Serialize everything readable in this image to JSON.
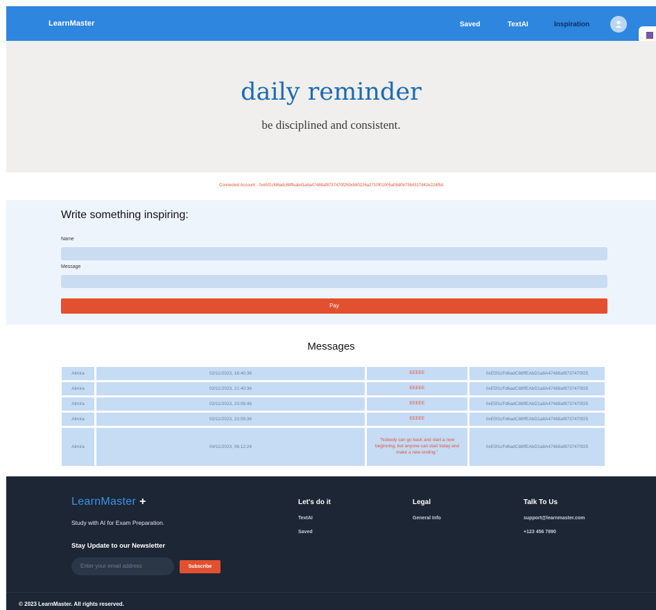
{
  "header": {
    "brand": "LearnMaster",
    "nav": {
      "saved": "Saved",
      "textai": "TextAI",
      "inspiration": "Inspiration"
    }
  },
  "hero": {
    "title": "daily reminder",
    "subtitle": "be disciplined and consistent."
  },
  "account": {
    "text": "Connected Account - 0xe5f1cfd6adc88ffeabd1a8a47488af8737470f250x580226a2710f01005a08d0b7384317d42e224f5d"
  },
  "form": {
    "title": "Write something inspiring:",
    "name_label": "Name",
    "message_label": "Message",
    "pay_label": "Pay"
  },
  "messages": {
    "title": "Messages",
    "rows": [
      {
        "name": "Almira",
        "date": "02/11/2023, 16:40:36",
        "message": "EEEEE",
        "address": "0xE5f1cFd6adC88ffEAbD1a8A47488af8737470f25"
      },
      {
        "name": "Almira",
        "date": "02/11/2023, 21:40:36",
        "message": "EEEEE",
        "address": "0xE5f1cFd6adC88ffEAbD1a8A47488af8737470f25"
      },
      {
        "name": "Almira",
        "date": "02/11/2023, 23:08:48",
        "message": "EEEEE",
        "address": "0xE5f1cFd6adC88ffEAbD1a8A47488af8737470f25"
      },
      {
        "name": "Almira",
        "date": "02/11/2023, 23:09:36",
        "message": "EEEEE",
        "address": "0xE5f1cFd6adC88ffEAbD1a8A47488af8737470f25"
      },
      {
        "name": "Almira",
        "date": "04/11/2023, 06:12:24",
        "message": "\"Nobody can go back and start a new beginning, but anyone can start today and make a new ending.\"",
        "address": "0xE5f1cFd6adC88ffEAbD1a8A47488af8737470f25"
      }
    ]
  },
  "footer": {
    "brand": "LearnMaster",
    "brand_plus": "+",
    "tagline": "Study with AI for Exam Preparation.",
    "newsletter_title": "Stay Update to our Newsletter",
    "email_placeholder": "Enter your email address",
    "subscribe_label": "Subscribe",
    "col1": {
      "title": "Let's do it",
      "links": [
        "TextAI",
        "Saved"
      ]
    },
    "col2": {
      "title": "Legal",
      "links": [
        "General Info"
      ]
    },
    "col3": {
      "title": "Talk To Us",
      "links": [
        "support@learnmaster.com",
        "+123 456 7890"
      ]
    },
    "copyright": "© 2023 LearnMaster. All rights reserved."
  },
  "colors": {
    "navbar": "#2e86de",
    "accent": "#e3502f",
    "title_blue": "#1e6ab1",
    "footer_bg": "#1c2634",
    "cell_bg": "#c6dbf4"
  },
  "icons": {
    "avatar": "user-icon",
    "extension": "extension-icon"
  }
}
